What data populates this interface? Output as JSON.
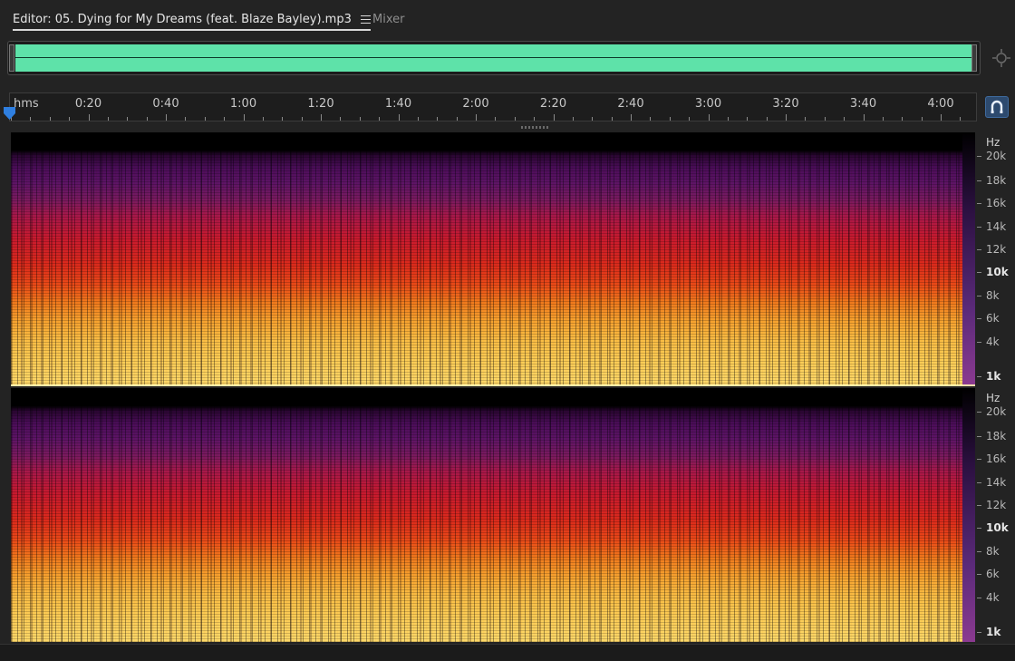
{
  "tabs": {
    "editor_label": "Editor: 05. Dying for My Dreams (feat. Blaze Bayley).mp3",
    "mixer_label": "Mixer"
  },
  "icons": {
    "menu": "hamburger-menu-icon",
    "zoom_nav": "zoom-navigator-icon",
    "snap": "snap-magnet-icon",
    "playhead": "playhead-marker-icon"
  },
  "colors": {
    "overview_waveform": "#5ee2a9",
    "snap_button": "#2d4a6e"
  },
  "ruler": {
    "unit": "hms",
    "labels": [
      "0:20",
      "0:40",
      "1:00",
      "1:20",
      "1:40",
      "2:00",
      "2:20",
      "2:40",
      "3:00",
      "3:20",
      "3:40",
      "4:00"
    ]
  },
  "frequency_scale": {
    "unit": "Hz",
    "labels": [
      "20k",
      "18k",
      "16k",
      "14k",
      "12k",
      "10k",
      "8k",
      "6k",
      "4k",
      "1k"
    ]
  }
}
